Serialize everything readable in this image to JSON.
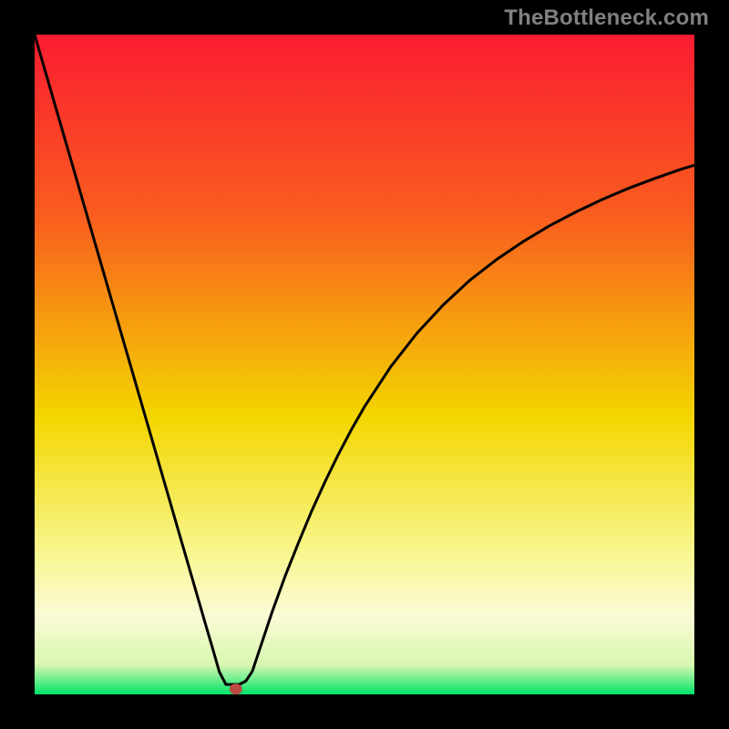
{
  "watermark": "TheBottleneck.com",
  "colors": {
    "bg_black": "#000000",
    "grad_top": "#fb1c32",
    "grad_25": "#f95f1e",
    "grad_50": "#f3d600",
    "grad_70": "#f8f68b",
    "grad_82": "#fbfbd6",
    "grad_94": "#d9f7b0",
    "grad_bottom": "#00e469",
    "curve": "#000000",
    "marker": "#bc4b44"
  },
  "chart_data": {
    "type": "line",
    "title": "",
    "xlabel": "",
    "ylabel": "",
    "xlim": [
      0,
      100
    ],
    "ylim": [
      0,
      100
    ],
    "x": [
      0,
      2,
      4,
      6,
      8,
      10,
      12,
      14,
      16,
      18,
      20,
      22,
      24,
      26,
      27,
      28,
      29,
      30,
      31,
      32,
      33,
      34,
      36,
      38,
      40,
      42,
      44,
      46,
      48,
      50,
      54,
      58,
      62,
      66,
      70,
      74,
      78,
      82,
      86,
      90,
      94,
      98,
      100
    ],
    "values": [
      100,
      93.1,
      86.2,
      79.3,
      72.4,
      65.5,
      58.6,
      51.7,
      44.8,
      37.9,
      31.0,
      24.1,
      17.2,
      10.3,
      6.9,
      3.4,
      1.5,
      1.5,
      1.5,
      2.0,
      3.5,
      6.5,
      12.5,
      18.0,
      23.0,
      27.8,
      32.2,
      36.3,
      40.1,
      43.6,
      49.7,
      54.8,
      59.1,
      62.8,
      65.9,
      68.6,
      71.0,
      73.1,
      75.0,
      76.7,
      78.2,
      79.6,
      80.2
    ],
    "marker": {
      "x": 30.5,
      "y": 0.8
    },
    "annotations": [],
    "legend": null
  }
}
